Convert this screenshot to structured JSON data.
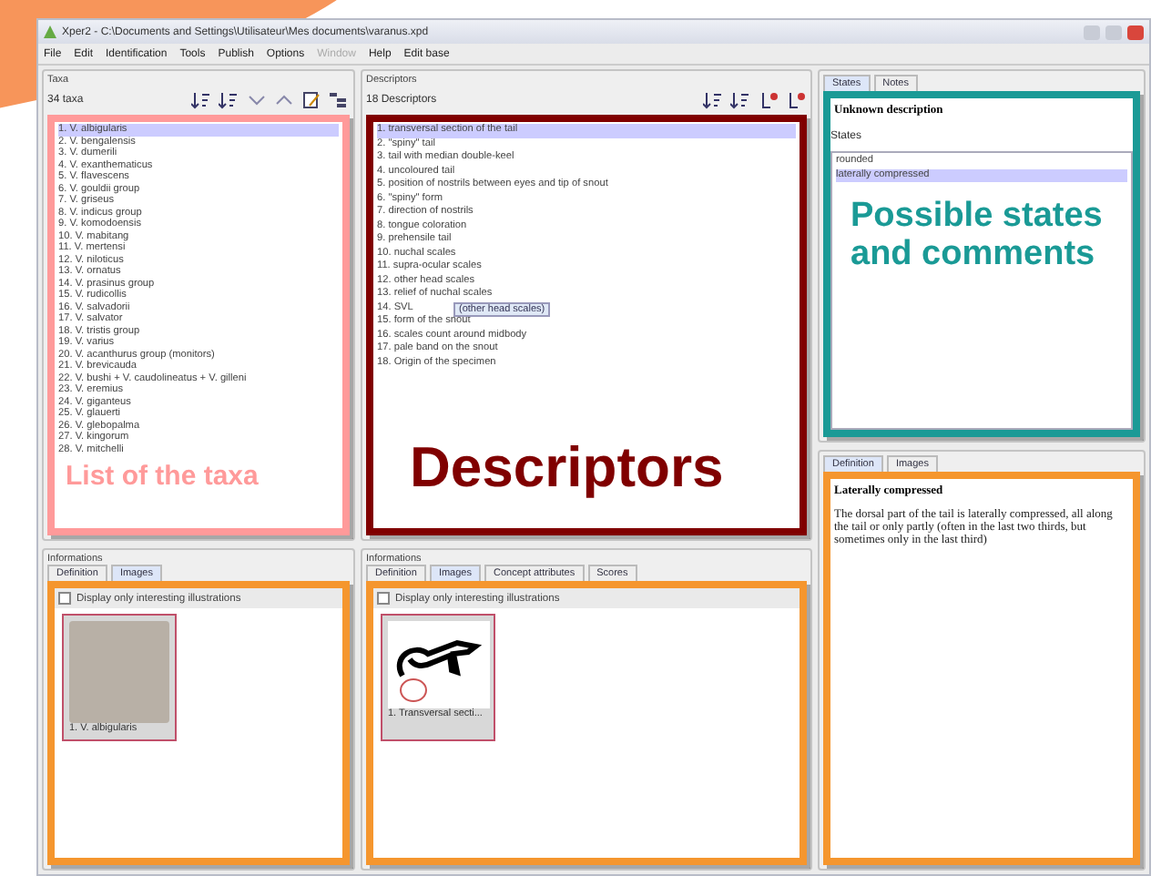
{
  "window": {
    "title": "Xper2 - C:\\Documents and Settings\\Utilisateur\\Mes documents\\varanus.xpd"
  },
  "menu": [
    {
      "label": "File",
      "disabled": false
    },
    {
      "label": "Edit",
      "disabled": false
    },
    {
      "label": "Identification",
      "disabled": false
    },
    {
      "label": "Tools",
      "disabled": false
    },
    {
      "label": "Publish",
      "disabled": false
    },
    {
      "label": "Options",
      "disabled": false
    },
    {
      "label": "Window",
      "disabled": true
    },
    {
      "label": "Help",
      "disabled": false
    },
    {
      "label": "Edit base",
      "disabled": false
    }
  ],
  "taxa_panel": {
    "title": "Taxa",
    "count": "34 taxa",
    "annotation": {
      "label": "List of the taxa",
      "color": "#ff9a9a"
    },
    "items": [
      {
        "label": "1. V. albigularis",
        "selected": true
      },
      {
        "label": "2. V. bengalensis",
        "selected": false
      },
      {
        "label": "3. V. dumerili",
        "selected": false
      },
      {
        "label": "4. V. exanthematicus",
        "selected": false
      },
      {
        "label": "5. V. flavescens",
        "selected": false
      },
      {
        "label": "6. V. gouldii group",
        "selected": false
      },
      {
        "label": "7. V. griseus",
        "selected": false
      },
      {
        "label": "8. V. indicus group",
        "selected": false
      },
      {
        "label": "9. V. komodoensis",
        "selected": false
      },
      {
        "label": "10. V. mabitang",
        "selected": false
      },
      {
        "label": "11. V. mertensi",
        "selected": false
      },
      {
        "label": "12. V. niloticus",
        "selected": false
      },
      {
        "label": "13. V. ornatus",
        "selected": false
      },
      {
        "label": "14. V. prasinus group",
        "selected": false
      },
      {
        "label": "15. V. rudicollis",
        "selected": false
      },
      {
        "label": "16. V. salvadorii",
        "selected": false
      },
      {
        "label": "17. V. salvator",
        "selected": false
      },
      {
        "label": "18. V. tristis group",
        "selected": false
      },
      {
        "label": "19. V. varius",
        "selected": false
      },
      {
        "label": "20. V. acanthurus group (monitors)",
        "selected": false
      },
      {
        "label": "21. V. brevicauda",
        "selected": false
      },
      {
        "label": "22. V. bushi + V. caudolineatus + V. gilleni",
        "selected": false
      },
      {
        "label": "23. V. eremius",
        "selected": false
      },
      {
        "label": "24. V. giganteus",
        "selected": false
      },
      {
        "label": "25. V. glauerti",
        "selected": false
      },
      {
        "label": "26. V. glebopalma",
        "selected": false
      },
      {
        "label": "27. V. kingorum",
        "selected": false
      },
      {
        "label": "28. V. mitchelli",
        "selected": false
      }
    ]
  },
  "descriptors_panel": {
    "title": "Descriptors",
    "count": "18 Descriptors",
    "annotation": {
      "label": "Descriptors",
      "color": "#800000"
    },
    "tooltip": "(other head scales)",
    "items": [
      {
        "label": "1. transversal section of the tail",
        "selected": true
      },
      {
        "label": "2. \"spiny\" tail",
        "selected": false
      },
      {
        "label": "3. tail with median double-keel",
        "selected": false
      },
      {
        "label": "4. uncoloured tail",
        "selected": false
      },
      {
        "label": "5. position of nostrils between eyes and tip of snout",
        "selected": false
      },
      {
        "label": "6. \"spiny\" form",
        "selected": false
      },
      {
        "label": "7. direction of nostrils",
        "selected": false
      },
      {
        "label": "8. tongue coloration",
        "selected": false
      },
      {
        "label": "9. prehensile tail",
        "selected": false
      },
      {
        "label": "10. nuchal scales",
        "selected": false
      },
      {
        "label": "11. supra-ocular scales",
        "selected": false
      },
      {
        "label": "12. other head scales",
        "selected": false
      },
      {
        "label": "13. relief of nuchal scales",
        "selected": false
      },
      {
        "label": "14. SVL",
        "selected": false
      },
      {
        "label": "15. form of the snout",
        "selected": false
      },
      {
        "label": "16. scales count around midbody",
        "selected": false
      },
      {
        "label": "17. pale band on the snout",
        "selected": false
      },
      {
        "label": "18. Origin of the specimen",
        "selected": false
      }
    ]
  },
  "states_panel": {
    "tabs": [
      {
        "label": "States",
        "selected": true
      },
      {
        "label": "Notes",
        "selected": false
      }
    ],
    "title": "Unknown description",
    "subtitle": "States",
    "annotation": {
      "label": "Possible states and comments",
      "color": "#1a9a96"
    },
    "items": [
      {
        "label": "rounded",
        "selected": false
      },
      {
        "label": "laterally compressed",
        "selected": true
      }
    ]
  },
  "definition_panel": {
    "tabs": [
      {
        "label": "Definition",
        "selected": true
      },
      {
        "label": "Images",
        "selected": false
      }
    ],
    "heading": "Laterally compressed",
    "text": "The dorsal part of the tail is laterally compressed, all along the tail or only partly (often in the last two thirds, but sometimes only in the last third)"
  },
  "taxa_info": {
    "title": "Informations",
    "tabs": [
      {
        "label": "Definition",
        "selected": false
      },
      {
        "label": "Images",
        "selected": true
      }
    ],
    "checkbox": {
      "label": "Display only interesting illustrations",
      "checked": false
    },
    "thumbnails": [
      {
        "caption": "1. V. albigularis",
        "kind": "photo"
      }
    ]
  },
  "descriptor_info": {
    "title": "Informations",
    "tabs": [
      {
        "label": "Definition",
        "selected": false
      },
      {
        "label": "Images",
        "selected": true
      },
      {
        "label": "Concept attributes",
        "selected": false
      },
      {
        "label": "Scores",
        "selected": false
      }
    ],
    "checkbox": {
      "label": "Display only interesting illustrations",
      "checked": false
    },
    "thumbnails": [
      {
        "caption": "1. Transversal secti...",
        "kind": "drawing"
      }
    ]
  }
}
